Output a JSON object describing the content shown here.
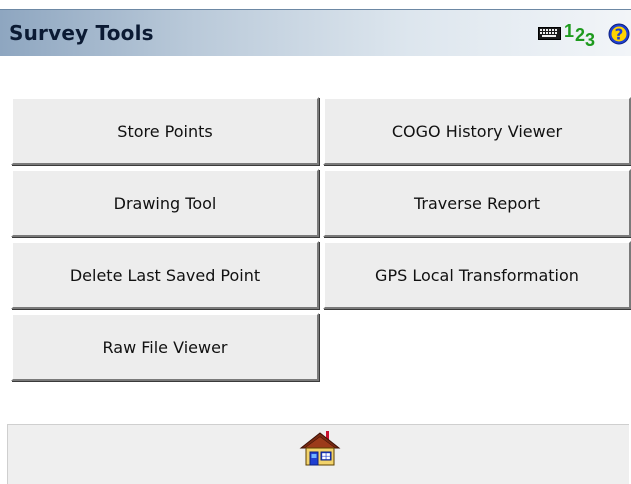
{
  "header": {
    "title": "Survey Tools",
    "icons": [
      "keyboard-icon",
      "numeric-input-icon",
      "help-icon"
    ],
    "numeric_glyphs": [
      "1",
      "2",
      "3"
    ],
    "numeric_color": "#1d9a1d",
    "help_color": "#1f3fd1",
    "help_glyph": "?"
  },
  "menu": {
    "buttons": [
      {
        "label": "Store Points"
      },
      {
        "label": "COGO History Viewer"
      },
      {
        "label": "Drawing Tool"
      },
      {
        "label": "Traverse Report"
      },
      {
        "label": "Delete Last Saved Point"
      },
      {
        "label": "GPS Local Transformation"
      },
      {
        "label": "Raw File Viewer"
      }
    ]
  },
  "footer": {
    "home_icon": "home-icon"
  },
  "colors": {
    "title_gradient_start": "#8ea6c0",
    "title_gradient_end": "#f2f5f8",
    "button_face": "#ededed",
    "title_text": "#0b1a33"
  }
}
